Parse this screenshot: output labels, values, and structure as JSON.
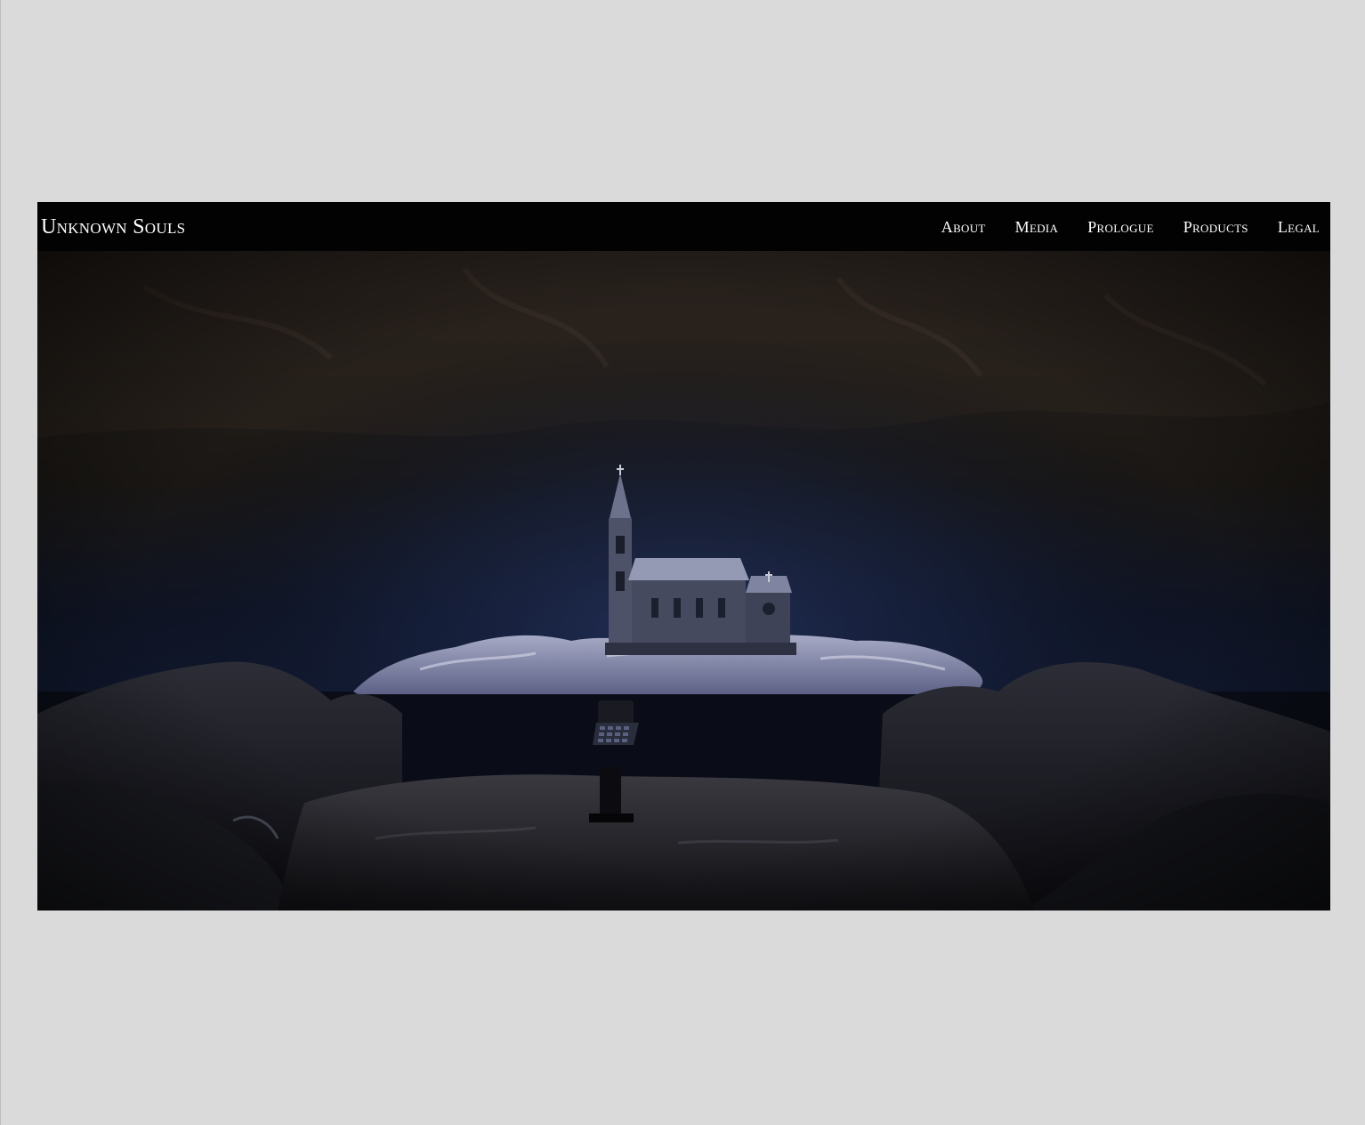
{
  "site": {
    "brand": "Unknown Souls"
  },
  "nav": {
    "items": [
      {
        "label": "About"
      },
      {
        "label": "Media"
      },
      {
        "label": "Prologue"
      },
      {
        "label": "Products"
      },
      {
        "label": "Legal"
      }
    ]
  },
  "hero": {
    "image": "cave-church-scene"
  },
  "colors": {
    "page_background": "#dadada",
    "navbar_background": "#020202",
    "nav_text": "#ffffff"
  }
}
